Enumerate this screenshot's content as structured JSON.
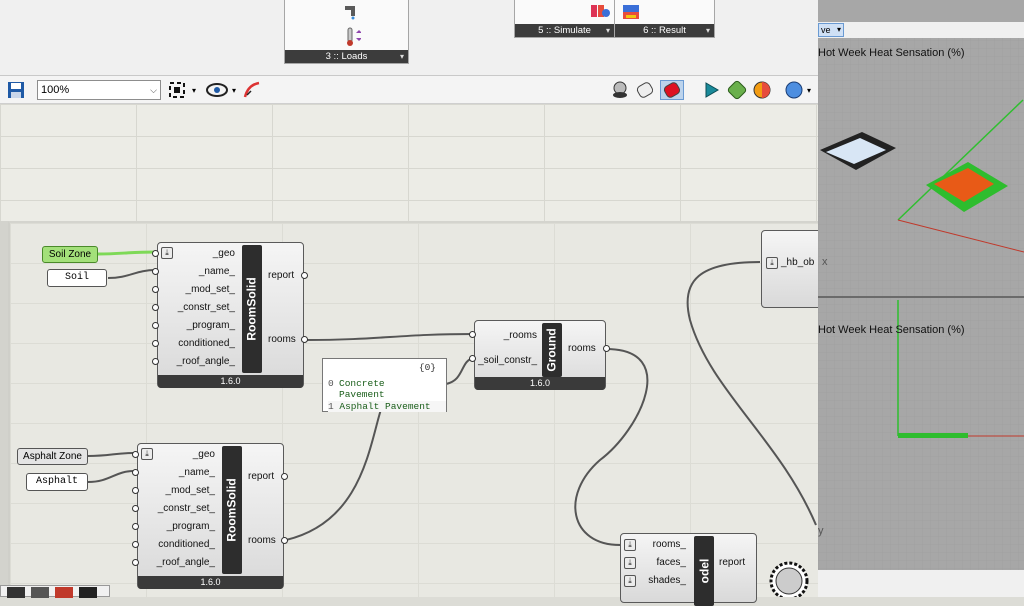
{
  "ribbon": {
    "panels": [
      {
        "label": "3 :: Loads"
      },
      {
        "label": "5 :: Simulate"
      },
      {
        "label": "6 :: Result"
      }
    ]
  },
  "toolbar": {
    "zoom": "100%"
  },
  "canvas": {
    "soil_zone": "Soil Zone",
    "soil": "Soil",
    "asphalt_zone": "Asphalt Zone",
    "asphalt": "Asphalt",
    "roomsolid1": {
      "name": "RoomSolid",
      "inputs": [
        "_geo",
        "_name_",
        "_mod_set_",
        "_constr_set_",
        "_program_",
        "conditioned_",
        "_roof_angle_"
      ],
      "outputs": [
        "report",
        "rooms"
      ],
      "version": "1.6.0"
    },
    "roomsolid2": {
      "name": "RoomSolid",
      "inputs": [
        "_geo",
        "_name_",
        "_mod_set_",
        "_constr_set_",
        "_program_",
        "conditioned_",
        "_roof_angle_"
      ],
      "outputs": [
        "report",
        "rooms"
      ],
      "version": "1.6.0"
    },
    "ground": {
      "name": "Ground",
      "inputs": [
        "_rooms",
        "_soil_constr_"
      ],
      "outputs": [
        "rooms"
      ],
      "version": "1.6.0"
    },
    "panel": {
      "header": "{0}",
      "items": [
        {
          "idx": "0",
          "text": "Concrete Pavement"
        },
        {
          "idx": "1",
          "text": "Asphalt Pavement"
        }
      ]
    },
    "hb_obj": {
      "input": "_hb_ob"
    },
    "model": {
      "name": "odel",
      "inputs": [
        "rooms_",
        "faces_",
        "shades_"
      ],
      "outputs": [
        "report"
      ]
    }
  },
  "viewport": {
    "top_dropdown": "ve",
    "top_title": "Hot Week Heat Sensation (%)",
    "bottom_title": "Hot Week Heat Sensation (%)",
    "axis_x": "x",
    "axis_y": "y"
  }
}
